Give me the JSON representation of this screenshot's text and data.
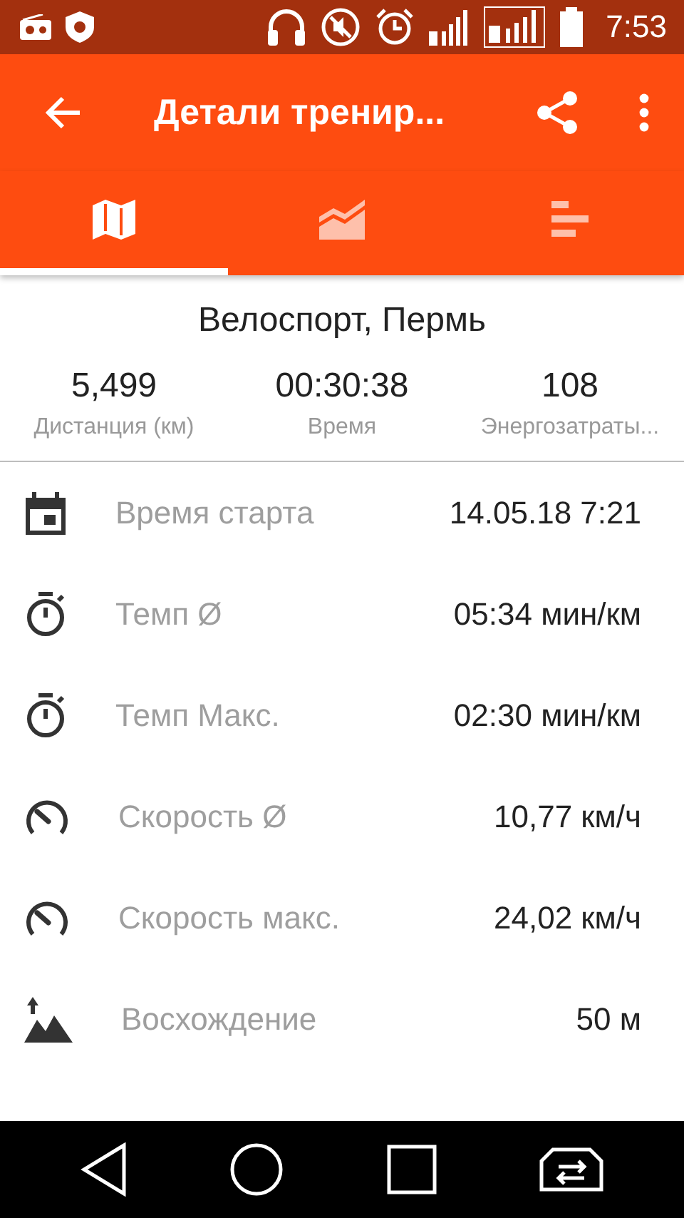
{
  "status_bar": {
    "time": "7:53"
  },
  "app_bar": {
    "title": "Детали тренир..."
  },
  "tabs": [
    {
      "kind": "map",
      "selected": true
    },
    {
      "kind": "chart",
      "selected": false
    },
    {
      "kind": "bars",
      "selected": false
    }
  ],
  "summary": {
    "title": "Велоспорт, Пермь",
    "stats": [
      {
        "value": "5,499",
        "label": "Дистанция (км)"
      },
      {
        "value": "00:30:38",
        "label": "Время"
      },
      {
        "value": "108",
        "label": "Энергозатраты..."
      }
    ]
  },
  "details": [
    {
      "kind": "calendar",
      "label": "Время старта",
      "value": "14.05.18 7:21"
    },
    {
      "kind": "stopwatch",
      "label": "Темп Ø",
      "value": "05:34 мин/км"
    },
    {
      "kind": "stopwatch",
      "label": "Темп Макс.",
      "value": "02:30 мин/км"
    },
    {
      "kind": "speed",
      "label": "Скорость Ø",
      "value": "10,77 км/ч"
    },
    {
      "kind": "speed",
      "label": "Скорость макс.",
      "value": "24,02 км/ч"
    },
    {
      "kind": "ascent",
      "label": "Восхождение",
      "value": "50 м"
    }
  ]
}
